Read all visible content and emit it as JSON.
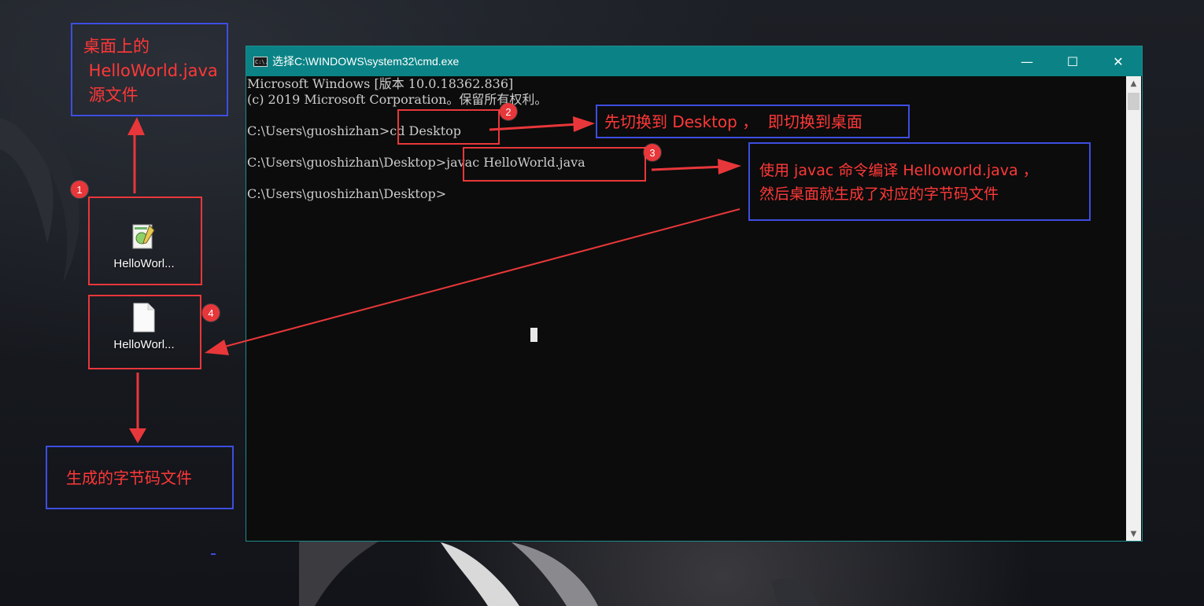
{
  "window": {
    "title": "选择C:\\WINDOWS\\system32\\cmd.exe",
    "icon_text": "C:\\.",
    "controls": {
      "minimize": "—",
      "maximize": "☐",
      "close": "✕"
    }
  },
  "console": {
    "lines": [
      "Microsoft Windows [版本 10.0.18362.836]",
      "(c) 2019 Microsoft Corporation。保留所有权利。",
      "",
      "C:\\Users\\guoshizhan>cd Desktop",
      "",
      "C:\\Users\\guoshizhan\\Desktop>javac HelloWorld.java",
      "",
      "C:\\Users\\guoshizhan\\Desktop>"
    ]
  },
  "desktop_icons": [
    {
      "name": "HelloWorl...",
      "icon": "java-source-file-icon"
    },
    {
      "name": "HelloWorl...",
      "icon": "class-file-icon"
    }
  ],
  "annotations": {
    "source_file": "桌面上的\n HelloWorld.java\n 源文件",
    "cd_desktop": "先切换到 Desktop ，  即切换到桌面",
    "javac": "使用 javac 命令编译 Helloworld.java ，\n然后桌面就生成了对应的字节码文件",
    "bytecode": "生成的字节码文件",
    "badges": [
      "1",
      "2",
      "3",
      "4"
    ]
  },
  "colors": {
    "annotation_red": "#e8373a",
    "annotation_blue": "#3d4ee0",
    "titlebar": "#0b8386",
    "console_bg": "#0c0c0c",
    "console_text": "#cccccc"
  }
}
